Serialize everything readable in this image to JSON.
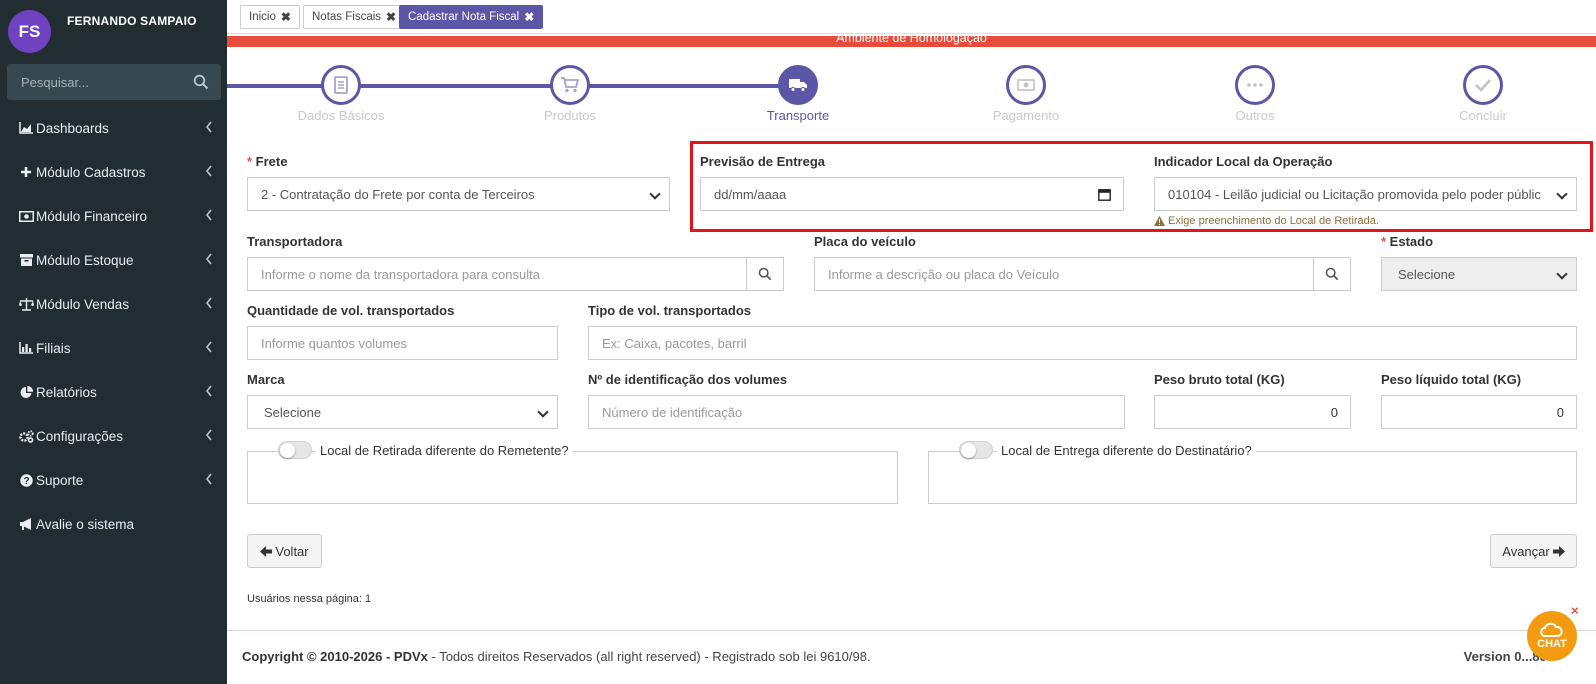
{
  "user": {
    "initials": "FS",
    "name": "FERNANDO SAMPAIO"
  },
  "sidebar": {
    "search_placeholder": "Pesquisar...",
    "items": [
      {
        "label": "Dashboards",
        "icon": "area-chart-icon"
      },
      {
        "label": "Módulo Cadastros",
        "icon": "plus-icon"
      },
      {
        "label": "Módulo Financeiro",
        "icon": "money-icon"
      },
      {
        "label": "Módulo Estoque",
        "icon": "archive-icon"
      },
      {
        "label": "Módulo Vendas",
        "icon": "balance-scale-icon"
      },
      {
        "label": "Filiais",
        "icon": "bar-chart-icon"
      },
      {
        "label": "Relatórios",
        "icon": "pie-chart-icon"
      },
      {
        "label": "Configurações",
        "icon": "cogs-icon"
      },
      {
        "label": "Suporte",
        "icon": "question-circle-icon"
      },
      {
        "label": "Avalie o sistema",
        "icon": "bullhorn-icon"
      }
    ]
  },
  "tabs": [
    {
      "label": "Inicio"
    },
    {
      "label": "Notas Fiscais"
    },
    {
      "label": "Cadastrar Nota Fiscal",
      "active": true
    }
  ],
  "environment": "Ambiente de Homologação",
  "steps": [
    {
      "label": "Dados Básicos",
      "icon": "file-icon",
      "state": "done"
    },
    {
      "label": "Produtos",
      "icon": "cart-icon",
      "state": "done"
    },
    {
      "label": "Transporte",
      "icon": "truck-icon",
      "state": "current"
    },
    {
      "label": "Pagamento",
      "icon": "money-icon",
      "state": "todo"
    },
    {
      "label": "Outros",
      "icon": "ellipsis-icon",
      "state": "todo"
    },
    {
      "label": "Concluir",
      "icon": "check-icon",
      "state": "todo"
    }
  ],
  "form": {
    "frete": {
      "label": "Frete",
      "value": "2 - Contratação do Frete por conta de Terceiros"
    },
    "previsao": {
      "label": "Previsão de Entrega",
      "placeholder": "dd/mm/aaaa"
    },
    "indicador": {
      "label": "Indicador Local da Operação",
      "value": "010104 - Leilão judicial ou Licitação promovida pelo poder públic",
      "warning": "Exige preenchimento do Local de Retirada."
    },
    "transportadora": {
      "label": "Transportadora",
      "placeholder": "Informe o nome da transportadora para consulta"
    },
    "placa": {
      "label": "Placa do veículo",
      "placeholder": "Informe a descrição ou placa do Veículo"
    },
    "estado": {
      "label": "Estado",
      "value": "Selecione"
    },
    "quantidade": {
      "label": "Quantidade de vol. transportados",
      "placeholder": "Informe quantos volumes"
    },
    "tipo": {
      "label": "Tipo de vol. transportados",
      "placeholder": "Ex: Caixa, pacotes, barril"
    },
    "marca": {
      "label": "Marca",
      "value": "Selecione"
    },
    "identificacao": {
      "label": "Nº de identificação dos volumes",
      "placeholder": "Número de identificação"
    },
    "peso_bruto": {
      "label": "Peso bruto total (KG)",
      "value": "0"
    },
    "peso_liquido": {
      "label": "Peso líquido total (KG)",
      "value": "0"
    },
    "retirada_toggle": "Local de Retirada diferente do Remetente?",
    "entrega_toggle": "Local de Entrega diferente do Destinatário?"
  },
  "buttons": {
    "voltar": "Voltar",
    "avancar": "Avançar"
  },
  "users_on_page": "Usuários nessa página: 1",
  "footer": {
    "copyright_bold": "Copyright © 2010-2026 - PDVx",
    "copyright_rest": " - Todos direitos Reservados (all right reserved) - Registrado sob lei 9610/98.",
    "version": "Version 0...800"
  },
  "chat": {
    "label": "CHAT",
    "close": "×"
  },
  "colors": {
    "accent": "#5b57a6",
    "sidebar": "#222d32",
    "env_bar": "#e74c3c",
    "highlight": "#e3141b",
    "chat": "#f39c12"
  }
}
